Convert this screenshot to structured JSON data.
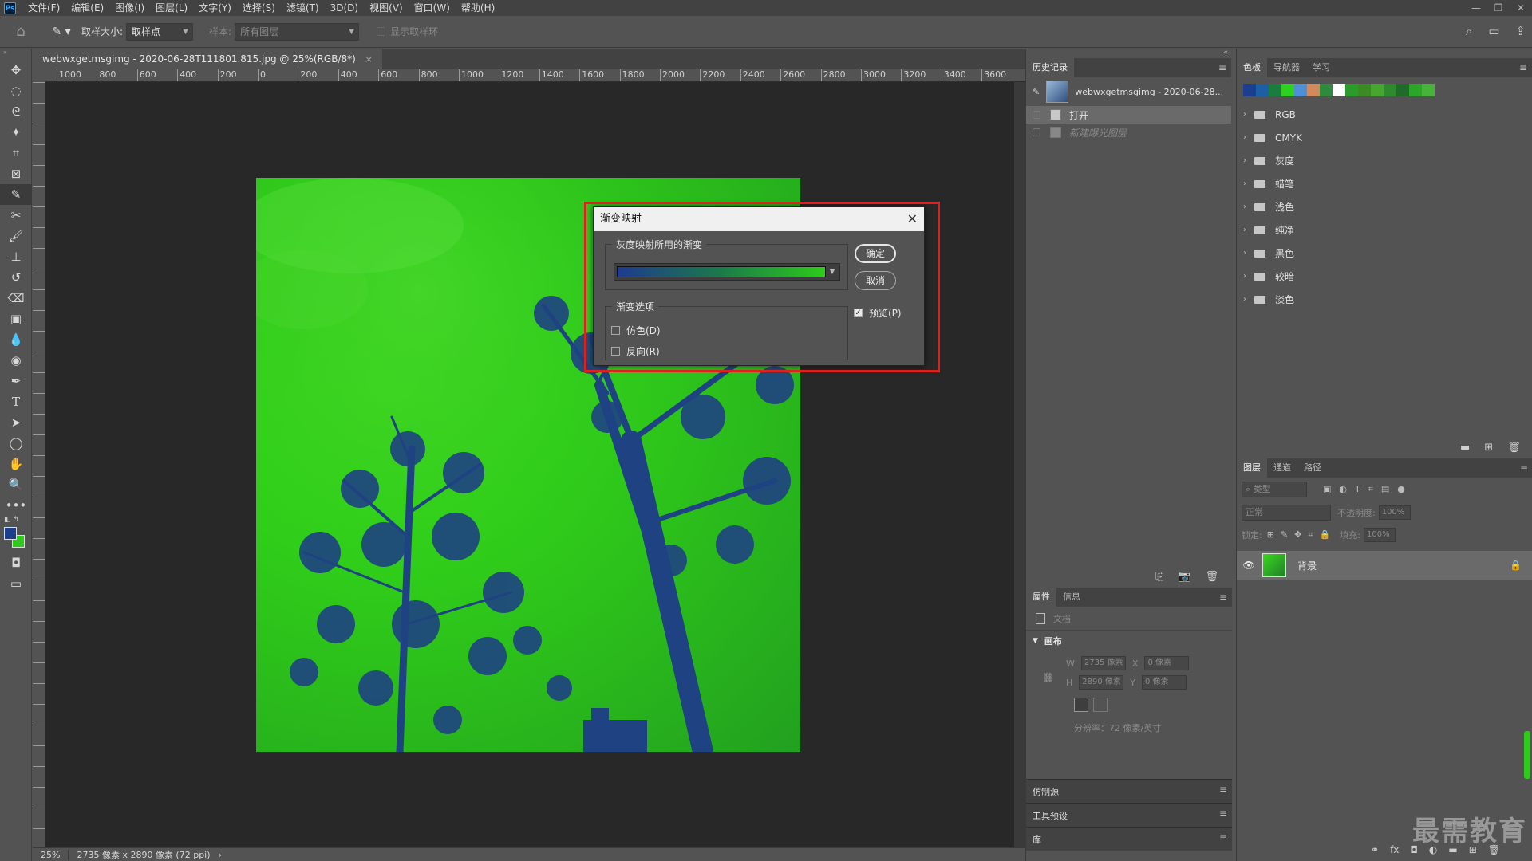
{
  "app": {
    "logo": "Ps"
  },
  "menu": [
    "文件(F)",
    "编辑(E)",
    "图像(I)",
    "图层(L)",
    "文字(Y)",
    "选择(S)",
    "滤镜(T)",
    "3D(D)",
    "视图(V)",
    "窗口(W)",
    "帮助(H)"
  ],
  "window_controls": {
    "minimize": "—",
    "restore": "❐",
    "close": "✕"
  },
  "options_bar": {
    "sample_size_label": "取样大小:",
    "sample_size_value": "取样点",
    "sample_label": "样本:",
    "sample_value": "所有图层",
    "show_ring_label": "显示取样环"
  },
  "document": {
    "tab_title": "webwxgetmsgimg - 2020-06-28T111801.815.jpg @ 25%(RGB/8*)",
    "tab_close": "×"
  },
  "ruler_top_labels": [
    "1000",
    "800",
    "600",
    "400",
    "200",
    "0",
    "200",
    "400",
    "600",
    "800",
    "1000",
    "1200",
    "1400",
    "1600",
    "1800",
    "2000",
    "2200",
    "2400",
    "2600",
    "2800",
    "3000",
    "3200",
    "3400",
    "3600"
  ],
  "statusbar": {
    "zoom": "25%",
    "doc_info": "2735 像素 x 2890 像素 (72 ppi)",
    "arrow": "›"
  },
  "dialog": {
    "title": "渐变映射",
    "close": "✕",
    "gradient_group_label": "灰度映射所用的渐变",
    "options_group_label": "渐变选项",
    "dither_label": "仿色(D)",
    "reverse_label": "反向(R)",
    "ok_label": "确定",
    "cancel_label": "取消",
    "preview_label": "预览(P)",
    "preview_checked": true,
    "gradient_colors": [
      "#1f3b8e",
      "#1c7a4a",
      "#2ecb1c"
    ]
  },
  "history_panel": {
    "tabs": [
      "历史记录"
    ],
    "snapshot_name": "webwxgetmsgimg - 2020-06-28...",
    "items": [
      {
        "label": "打开",
        "selected": true
      },
      {
        "label": "新建曝光图层",
        "selected": false,
        "dimmed": true
      }
    ]
  },
  "swatches_panel": {
    "tabs": [
      "色板",
      "导航器",
      "学习"
    ],
    "swatch_colors": [
      "#1b3f8f",
      "#1d5ea5",
      "#1a7d3d",
      "#2ed11d",
      "#4f8fd6",
      "#d18a5f",
      "#2f8a3c",
      "#ffffff",
      "#2b9b2b",
      "#3c8a26",
      "#46a62f",
      "#2e8a2e",
      "#1f6b28",
      "#2aa62a",
      "#47b33a"
    ],
    "folders": [
      "RGB",
      "CMYK",
      "灰度",
      "蜡笔",
      "浅色",
      "纯净",
      "黑色",
      "较暗",
      "淡色"
    ]
  },
  "properties_panel": {
    "tabs": [
      "属性",
      "信息"
    ],
    "doc_label": "文档",
    "canvas_section": "画布",
    "w_label": "W",
    "w_value": "2735 像素",
    "h_label": "H",
    "h_value": "2890 像素",
    "x_label": "X",
    "x_value": "0 像素",
    "y_label": "Y",
    "y_value": "0 像素",
    "resolution": "分辨率：72 像素/英寸"
  },
  "mini_panels": [
    "仿制源",
    "工具预设",
    "库"
  ],
  "layers_panel": {
    "tabs": [
      "图层",
      "通道",
      "路径"
    ],
    "filter_placeholder": "类型",
    "blend_mode": "正常",
    "opacity_label": "不透明度:",
    "opacity_value": "100%",
    "lock_label": "锁定:",
    "fill_label": "填充:",
    "fill_value": "100%",
    "layer_name": "背景"
  },
  "watermark": "最需教育"
}
